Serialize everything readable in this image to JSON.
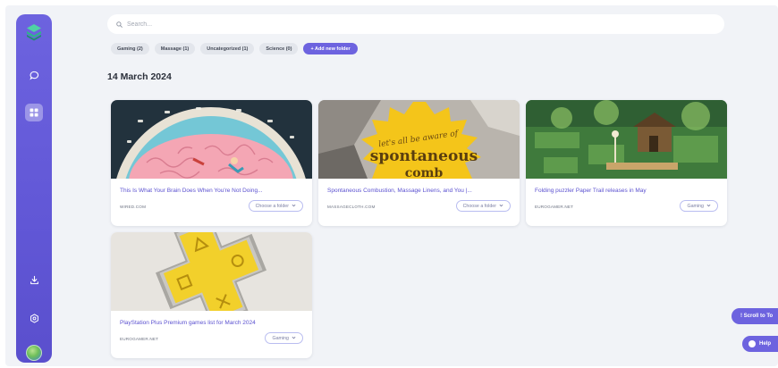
{
  "search": {
    "placeholder": "Search..."
  },
  "folders": [
    {
      "label": "Gaming (2)"
    },
    {
      "label": "Massage (1)"
    },
    {
      "label": "Uncategorized (1)"
    },
    {
      "label": "Science (0)"
    }
  ],
  "add_folder_label": "+ Add new folder",
  "date_heading": "14 March 2024",
  "cards": [
    {
      "title": "This Is What Your Brain Does When You're Not Doing...",
      "source": "WIRED.COM",
      "folder_label": "Choose a folder"
    },
    {
      "title": "Spontaneous Combustion, Massage Linens, and You |...",
      "source": "MASSAGECLOTH.COM",
      "folder_label": "Choose a folder",
      "image_text_1": "let's all be aware of",
      "image_text_2": "spontaneous",
      "image_text_3": "comb"
    },
    {
      "title": "Folding puzzler Paper Trail releases in May",
      "source": "EUROGAMER.NET",
      "folder_label": "Gaming"
    },
    {
      "title": "PlayStation Plus Premium games list for March 2024",
      "source": "EUROGAMER.NET",
      "folder_label": "Gaming"
    }
  ],
  "scroll_to_top_label": "! Scroll to To",
  "help_label": "Help",
  "colors": {
    "accent": "#6d63df",
    "link": "#5b51d0",
    "background": "#f1f3f7"
  }
}
